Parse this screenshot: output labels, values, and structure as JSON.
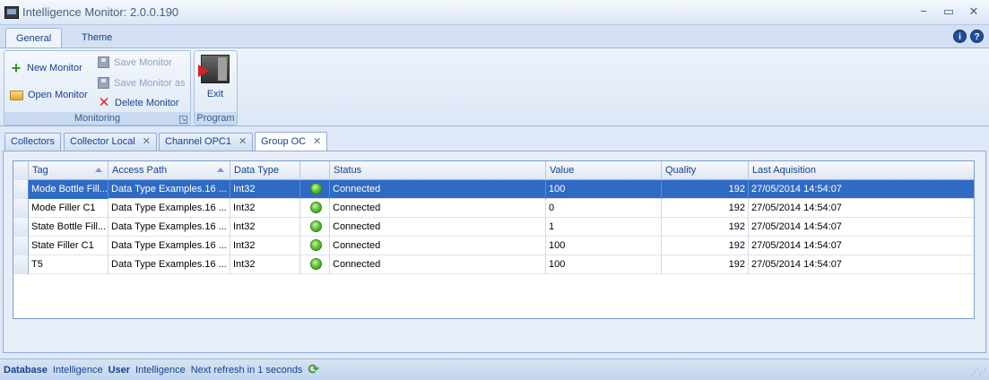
{
  "window": {
    "title": "Intelligence Monitor: 2.0.0.190",
    "controls": {
      "minimize": "−",
      "restore": "▭",
      "close": "✕"
    }
  },
  "ribbon": {
    "tabs": [
      {
        "label": "General",
        "active": true
      },
      {
        "label": "Theme",
        "active": false
      }
    ],
    "help_icons": {
      "info": "i",
      "help": "?"
    },
    "groups": {
      "monitoring": {
        "label": "Monitoring",
        "new_monitor": "New Monitor",
        "open_monitor": "Open Monitor",
        "save_monitor": "Save Monitor",
        "save_monitor_as": "Save Monitor as",
        "delete_monitor": "Delete Monitor"
      },
      "program": {
        "label": "Program",
        "exit": "Exit"
      }
    }
  },
  "doc_tabs": [
    {
      "label": "Collectors",
      "closable": false
    },
    {
      "label": "Collector Local",
      "closable": true
    },
    {
      "label": "Channel OPC1",
      "closable": true
    },
    {
      "label": "Group OC",
      "closable": true,
      "active": true
    }
  ],
  "grid": {
    "columns": [
      "Tag",
      "Access Path",
      "Data Type",
      "",
      "Status",
      "Value",
      "Quality",
      "Last Aquisition"
    ],
    "rows": [
      {
        "tag": "Mode Bottle Fill...",
        "access_path": "Data Type Examples.16 ...",
        "data_type": "Int32",
        "status": "Connected",
        "value": "100",
        "quality": "192",
        "last_aquisition": "27/05/2014 14:54:07",
        "selected": true
      },
      {
        "tag": "Mode Filler C1",
        "access_path": "Data Type Examples.16 ...",
        "data_type": "Int32",
        "status": "Connected",
        "value": "0",
        "quality": "192",
        "last_aquisition": "27/05/2014 14:54:07"
      },
      {
        "tag": "State Bottle Fill...",
        "access_path": "Data Type Examples.16 ...",
        "data_type": "Int32",
        "status": "Connected",
        "value": "1",
        "quality": "192",
        "last_aquisition": "27/05/2014 14:54:07"
      },
      {
        "tag": "State Filler C1",
        "access_path": "Data Type Examples.16 ...",
        "data_type": "Int32",
        "status": "Connected",
        "value": "100",
        "quality": "192",
        "last_aquisition": "27/05/2014 14:54:07"
      },
      {
        "tag": "T5",
        "access_path": "Data Type Examples.16 ...",
        "data_type": "Int32",
        "status": "Connected",
        "value": "100",
        "quality": "192",
        "last_aquisition": "27/05/2014 14:54:07"
      }
    ],
    "row_indicator": "›",
    "status_led_color": "#62c732"
  },
  "statusbar": {
    "database_label": "Database",
    "database_value": "Intelligence",
    "user_label": "User",
    "user_value": "Intelligence",
    "refresh_text": "Next refresh in 1 seconds"
  }
}
